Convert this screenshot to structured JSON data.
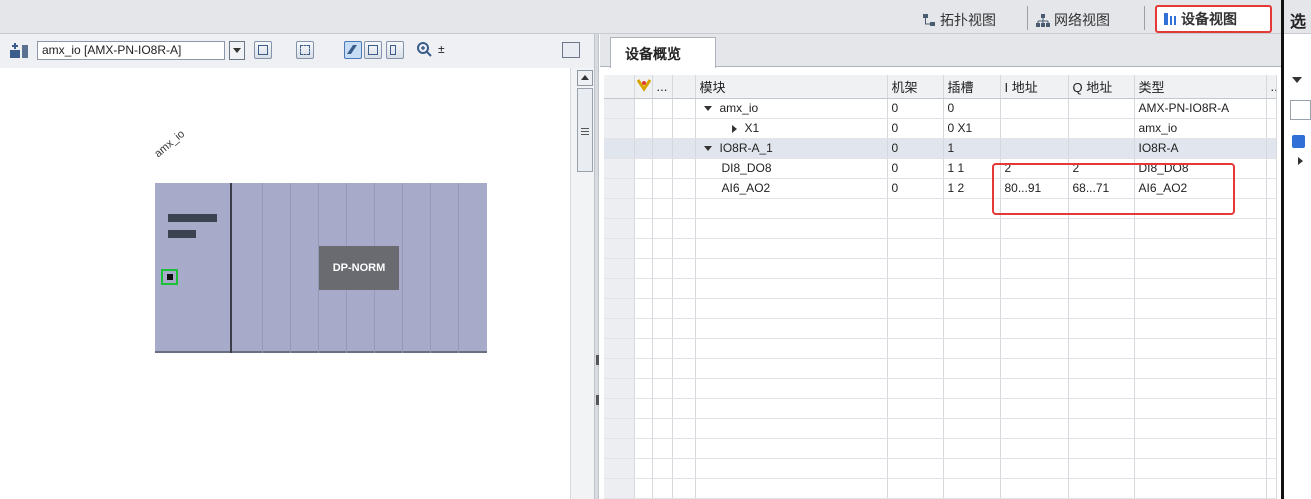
{
  "view_tabs": {
    "topology": "拓扑视图",
    "network": "网络视图",
    "device": "设备视图",
    "right_cut": "选"
  },
  "toolbar": {
    "device_selector": "amx_io [AMX-PN-IO8R-A]",
    "zoom_suffix": "±"
  },
  "canvas": {
    "device_label": "amx_io",
    "module_label": "DP-NORM"
  },
  "overview": {
    "tab": "设备概览",
    "columns": [
      "",
      "...",
      "模块",
      "机架",
      "插槽",
      "I 地址",
      "Q 地址",
      "类型",
      "..."
    ],
    "rows": [
      {
        "expander": "down",
        "module": "amx_io",
        "rack": "0",
        "slot": "0",
        "i_addr": "",
        "q_addr": "",
        "type": "AMX-PN-IO8R-A",
        "selected": false
      },
      {
        "expander": "right",
        "module": "X1",
        "rack": "0",
        "slot": "0 X1",
        "i_addr": "",
        "q_addr": "",
        "type": "amx_io",
        "selected": false
      },
      {
        "expander": "down",
        "module": "IO8R-A_1",
        "rack": "0",
        "slot": "1",
        "i_addr": "",
        "q_addr": "",
        "type": "IO8R-A",
        "selected": true
      },
      {
        "expander": "",
        "module": "DI8_DO8",
        "rack": "0",
        "slot": "1 1",
        "i_addr": "2",
        "q_addr": "2",
        "type": "DI8_DO8",
        "selected": false
      },
      {
        "expander": "",
        "module": "AI6_AO2",
        "rack": "0",
        "slot": "1 2",
        "i_addr": "80...91",
        "q_addr": "68...71",
        "type": "AI6_AO2",
        "selected": false
      }
    ],
    "empty_rows": 15
  },
  "colors": {
    "highlight": "#e53935",
    "rack": "#a7abc9",
    "module": "#696b70",
    "port": "#19c235"
  }
}
